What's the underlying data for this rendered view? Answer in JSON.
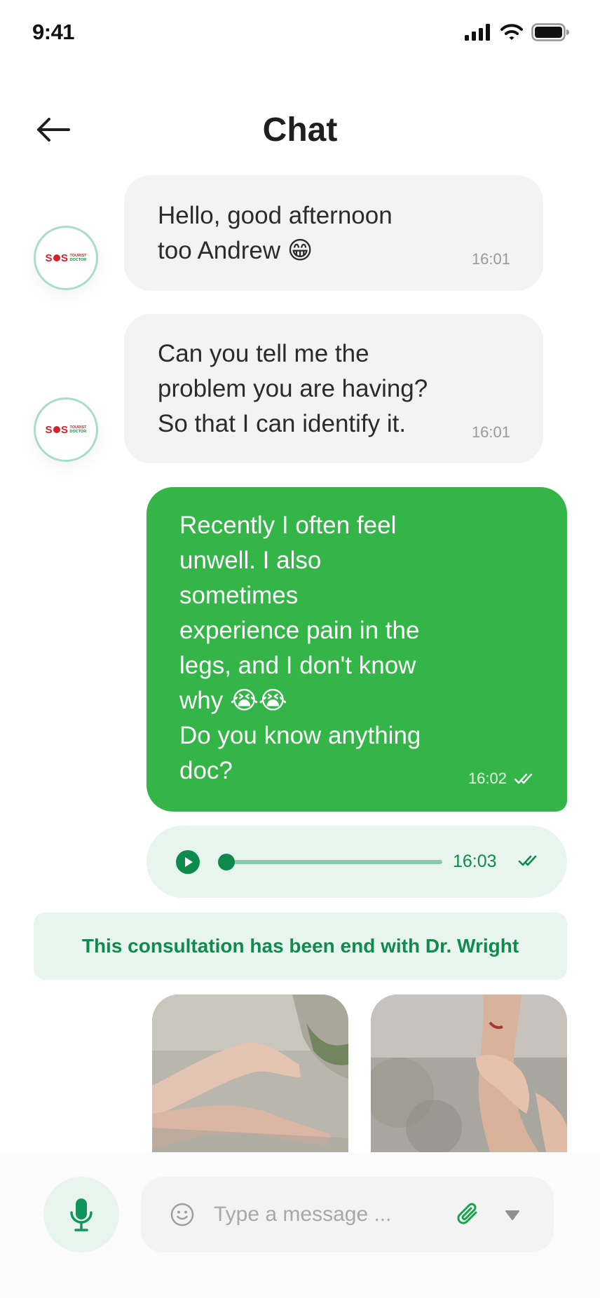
{
  "status_bar": {
    "time": "9:41"
  },
  "header": {
    "title": "Chat"
  },
  "messages": [
    {
      "sender": "doctor",
      "text_lines": [
        "Hello, good afternoon",
        "too Andrew 😁"
      ],
      "time": "16:01"
    },
    {
      "sender": "doctor",
      "text_lines": [
        "Can you tell me the",
        "problem you are having?",
        "So that I can identify it."
      ],
      "time": "16:01"
    },
    {
      "sender": "user",
      "text_lines": [
        "Recently I often feel",
        "unwell. I also",
        "sometimes",
        "experience pain in the",
        "legs, and I don't know",
        "why 😭😭",
        "Do you know anything",
        "doc?"
      ],
      "time": "16:02",
      "status": "read"
    }
  ],
  "voice_message": {
    "time": "16:03",
    "progress": 0,
    "status": "read"
  },
  "notice": {
    "text": "This consultation has been end with Dr. Wright"
  },
  "doctor_logo": {
    "brand": "SOS",
    "sub_top": "TOURIST",
    "sub_bottom": "DOCTOR"
  },
  "composer": {
    "placeholder": "Type a message ..."
  },
  "colors": {
    "accent_green": "#34b548",
    "dark_green": "#0e8a4c",
    "light_green_bg": "#e8f5ee",
    "incoming_bubble": "#f3f3f3",
    "logo_red": "#d8202a"
  },
  "icons": {
    "back": "arrow-left-icon",
    "signal": "cellular-signal-icon",
    "wifi": "wifi-icon",
    "battery": "battery-icon",
    "play": "play-icon",
    "read": "double-check-icon",
    "mic": "microphone-icon",
    "emoji": "smiley-icon",
    "attach": "paperclip-icon",
    "more": "triangle-down-icon"
  }
}
